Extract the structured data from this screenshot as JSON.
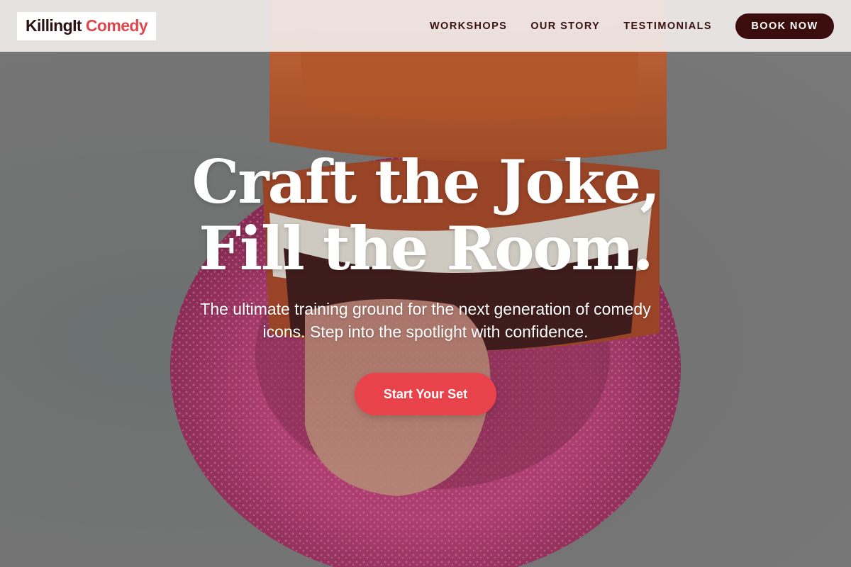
{
  "brand": {
    "name_part1": "KillingIt",
    "name_part2": "Comedy"
  },
  "nav": {
    "links": [
      "WORKSHOPS",
      "OUR STORY",
      "TESTIMONIALS"
    ],
    "book_label": "BOOK NOW"
  },
  "hero": {
    "headline_line1": "Craft the Joke,",
    "headline_line2": "Fill the Room.",
    "subtext": "The ultimate training ground for the next generation of comedy icons. Step into the spotlight with confidence.",
    "cta_label": "Start Your Set",
    "image_subject": "wind-up chattering teeth toy with tongue on pink fuzzy base"
  },
  "colors": {
    "accent": "#e8434a",
    "brand_dark": "#3c0d0d",
    "nav_bg": "#f0ecea",
    "headline": "#ffffff"
  }
}
